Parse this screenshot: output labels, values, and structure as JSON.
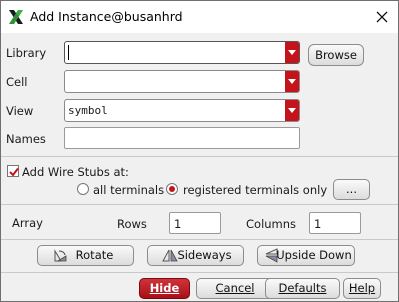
{
  "window": {
    "title": "Add Instance@busanhrd",
    "icon": "x-logo-icon"
  },
  "form": {
    "library": {
      "label": "Library",
      "value": ""
    },
    "cell": {
      "label": "Cell",
      "value": ""
    },
    "view": {
      "label": "View",
      "value": "symbol"
    },
    "names": {
      "label": "Names",
      "value": ""
    },
    "browse_label": "Browse"
  },
  "wire_stubs": {
    "label": "Add Wire Stubs at:",
    "checked": true,
    "options": [
      {
        "label": "all terminals",
        "selected": false
      },
      {
        "label": "registered terminals only",
        "selected": true
      }
    ],
    "more_label": "..."
  },
  "array": {
    "label": "Array",
    "rows_label": "Rows",
    "rows_value": "1",
    "columns_label": "Columns",
    "columns_value": "1"
  },
  "transform_buttons": {
    "rotate": "Rotate",
    "sideways": "Sideways",
    "upside_down": "Upside Down"
  },
  "footer": {
    "hide": "Hide",
    "cancel": "Cancel",
    "defaults": "Defaults",
    "help": "Help"
  },
  "colors": {
    "accent": "#c5131c"
  }
}
